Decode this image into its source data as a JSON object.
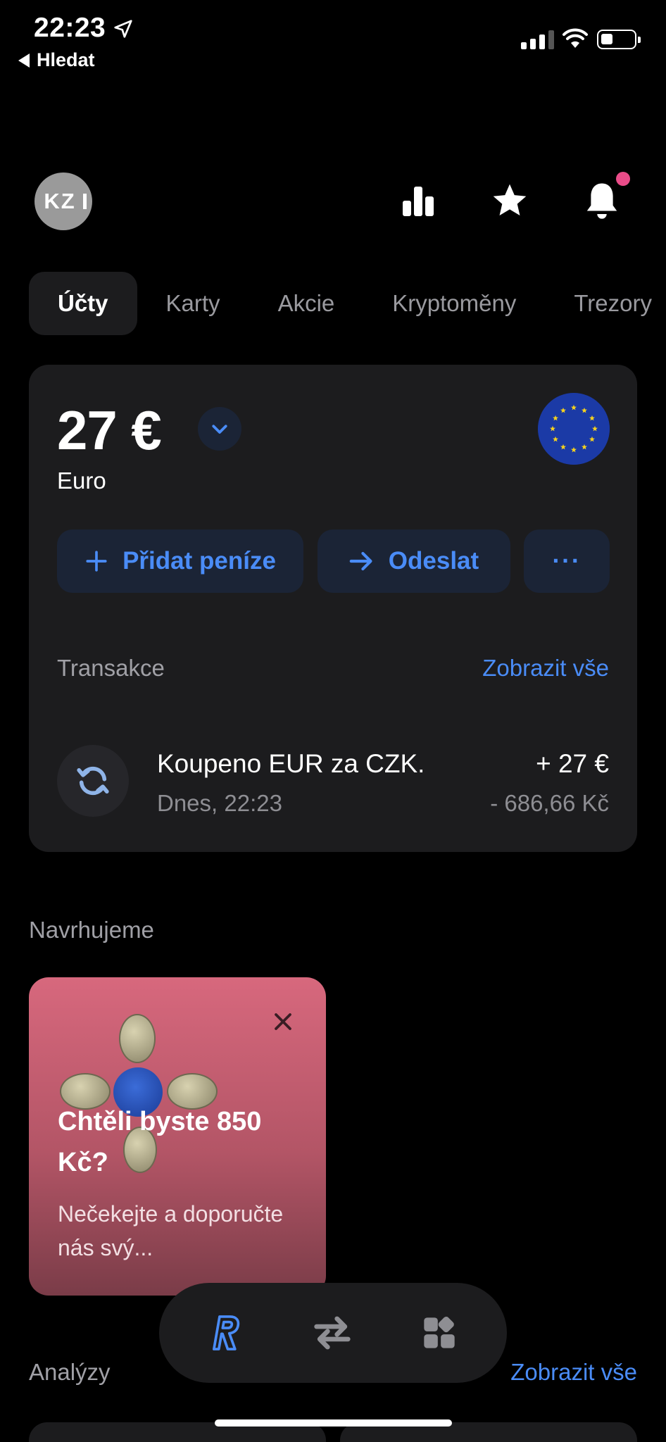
{
  "status_bar": {
    "time": "22:23",
    "back_label": "Hledat"
  },
  "header": {
    "avatar_initials": "KZ",
    "icons": [
      "analytics-icon",
      "star-icon",
      "bell-icon"
    ],
    "notification_dot_color": "#ea4c89"
  },
  "tabs": [
    {
      "label": "Účty",
      "active": true
    },
    {
      "label": "Karty",
      "active": false
    },
    {
      "label": "Akcie",
      "active": false
    },
    {
      "label": "Kryptoměny",
      "active": false
    },
    {
      "label": "Trezory",
      "active": false
    }
  ],
  "account": {
    "balance": "27 €",
    "currency_name": "Euro",
    "flag": "eu-flag",
    "buttons": {
      "add_money": "Přidat peníze",
      "send": "Odeslat",
      "more": "···"
    }
  },
  "transactions": {
    "title": "Transakce",
    "view_all": "Zobrazit vše",
    "items": [
      {
        "name": "Koupeno EUR za CZK.",
        "time": "Dnes, 22:23",
        "amount": "+ 27 €",
        "sub_amount": "- 686,66 Kč",
        "icon": "exchange-icon"
      }
    ]
  },
  "suggestions": {
    "title": "Navrhujeme",
    "cards": [
      {
        "headline": "Chtěli byste 850 Kč?",
        "body": "Nečekejte a doporučte nás svý..."
      }
    ]
  },
  "analyses": {
    "title": "Analýzy",
    "view_all": "Zobrazit vše"
  },
  "bottom_nav": {
    "items": [
      "home-logo-icon",
      "transfers-icon",
      "hub-icon"
    ],
    "active": "home-logo-icon"
  },
  "colors": {
    "accent": "#4a8cf7",
    "background": "#000000",
    "card": "#1c1c1e",
    "promo": "#d7687d"
  }
}
